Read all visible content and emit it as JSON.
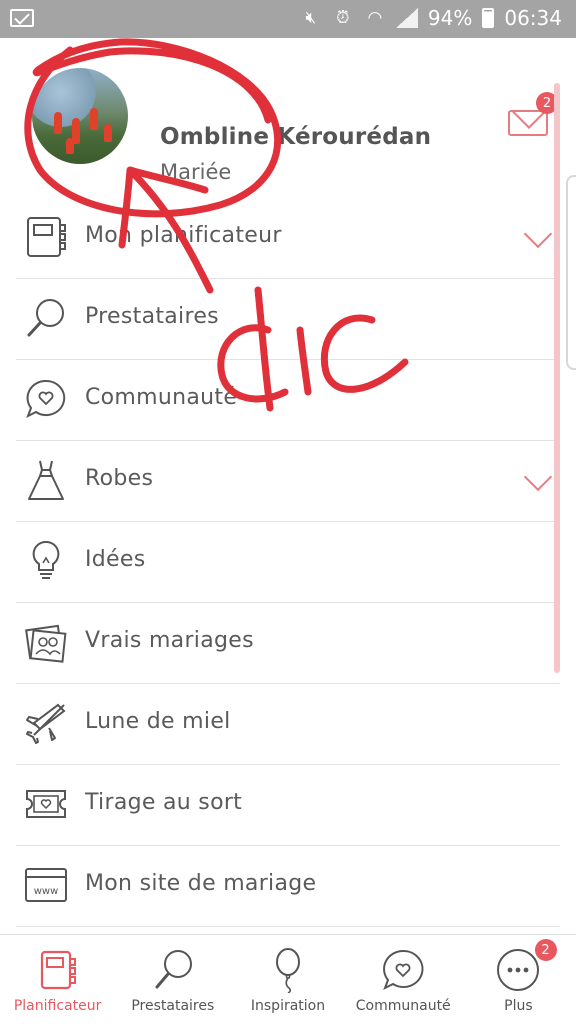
{
  "status_bar": {
    "battery": "94%",
    "time": "06:34"
  },
  "profile": {
    "name": "Ombline Kérourédan",
    "role": "Mariée",
    "messages_badge": "2"
  },
  "menu": [
    {
      "label": "Mon planificateur",
      "icon": "planner-icon",
      "expandable": true
    },
    {
      "label": "Prestataires",
      "icon": "magnifier-icon",
      "expandable": false
    },
    {
      "label": "Communauté",
      "icon": "chat-heart-icon",
      "expandable": false
    },
    {
      "label": "Robes",
      "icon": "dress-icon",
      "expandable": true
    },
    {
      "label": "Idées",
      "icon": "lightbulb-icon",
      "expandable": false
    },
    {
      "label": "Vrais mariages",
      "icon": "photos-icon",
      "expandable": false
    },
    {
      "label": "Lune de miel",
      "icon": "plane-icon",
      "expandable": false
    },
    {
      "label": " Tirage au sort",
      "icon": "ticket-icon",
      "expandable": false
    },
    {
      "label": "Mon site de mariage",
      "icon": "www-icon",
      "expandable": false
    }
  ],
  "tabs": [
    {
      "label": "Planificateur",
      "icon": "planner-icon",
      "active": true
    },
    {
      "label": "Prestataires",
      "icon": "magnifier-icon",
      "active": false
    },
    {
      "label": "Inspiration",
      "icon": "balloon-icon",
      "active": false
    },
    {
      "label": "Communauté",
      "icon": "chat-heart-icon",
      "active": false
    },
    {
      "label": "Plus",
      "icon": "more-icon",
      "active": false,
      "badge": "2"
    }
  ],
  "annotation": {
    "text": "clic",
    "color": "#e0313a"
  },
  "colors": {
    "accent": "#e8585f",
    "icon_accent": "#e67c81",
    "status_bar": "#a4a4a4"
  }
}
